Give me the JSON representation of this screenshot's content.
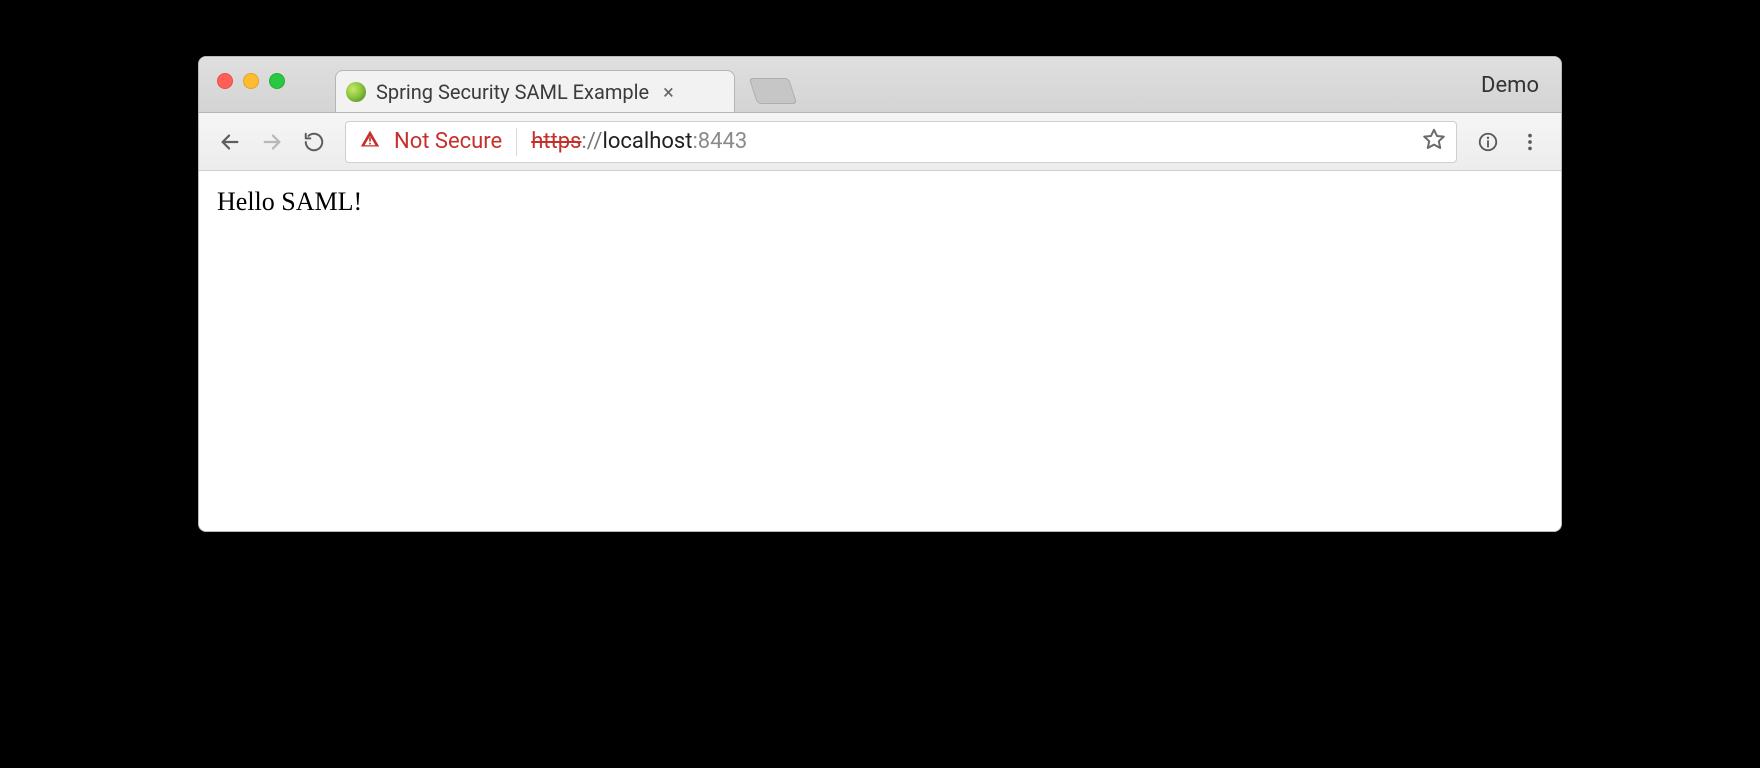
{
  "window": {
    "profile_label": "Demo"
  },
  "tab": {
    "title": "Spring Security SAML Example"
  },
  "addressbar": {
    "security_label": "Not Secure",
    "url_scheme": "https",
    "url_sep": "://",
    "url_host": "localhost",
    "url_port": ":8443"
  },
  "page": {
    "body_text": "Hello SAML!"
  }
}
